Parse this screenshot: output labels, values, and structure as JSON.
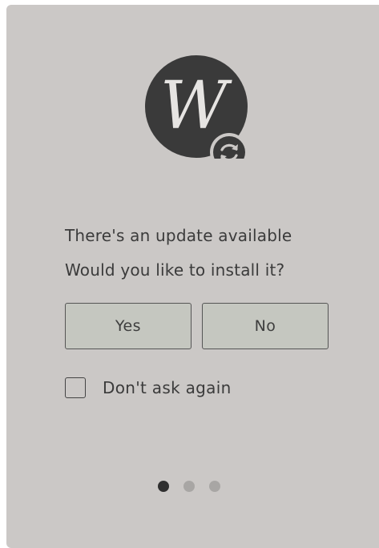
{
  "dialog": {
    "message_line1": "There's an update available",
    "message_line2": "Would you like to install it?",
    "yes_label": "Yes",
    "no_label": "No",
    "dont_ask_label": "Don't ask again",
    "dont_ask_checked": false
  },
  "logo": {
    "letter": "W",
    "badge_icon": "sync-arrows-icon"
  },
  "pager": {
    "total": 3,
    "active_index": 0
  },
  "colors": {
    "background": "#cbc8c6",
    "logo": "#3a3a3a",
    "dot_active": "#2f2f2f",
    "dot_inactive": "#a8a6a4"
  }
}
